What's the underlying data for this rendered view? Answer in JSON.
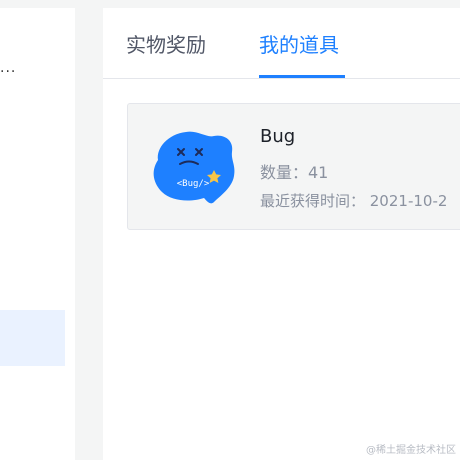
{
  "sidebar": {
    "ellipsis": "..."
  },
  "tabs": [
    {
      "label": "实物奖励",
      "active": false
    },
    {
      "label": "我的道具",
      "active": true
    }
  ],
  "item": {
    "name": "Bug",
    "image_text": "<Bug/>",
    "quantity": "数量：41",
    "obtained_time": "最近获得时间：  2021-10-2"
  },
  "watermark": "@稀土掘金技术社区",
  "colors": {
    "accent": "#1e80ff",
    "bug_body": "#1e80ff",
    "star": "#f7c548"
  }
}
